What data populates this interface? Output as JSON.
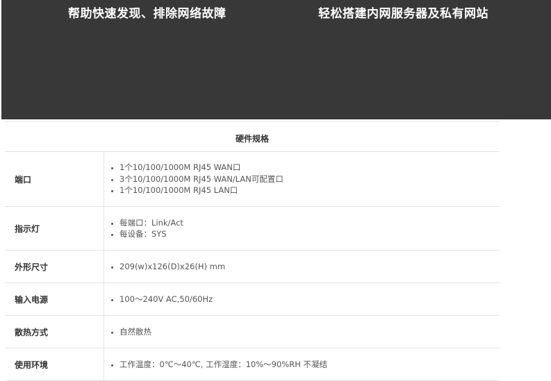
{
  "banner": {
    "left_caption": "帮助快速发现、排除网络故障",
    "right_caption": "轻松搭建内网服务器及私有网站"
  },
  "spec": {
    "title": "硬件规格",
    "rows": [
      {
        "label": "端口",
        "items": [
          "1个10/100/1000M RJ45 WAN口",
          "3个10/100/1000M RJ45 WAN/LAN可配置口",
          "1个10/100/1000M RJ45 LAN口"
        ]
      },
      {
        "label": "指示灯",
        "items": [
          "每端口：Link/Act",
          "每设备：SYS"
        ]
      },
      {
        "label": "外形尺寸",
        "items": [
          "209(w)x126(D)x26(H) mm"
        ]
      },
      {
        "label": "输入电源",
        "items": [
          "100～240V AC,50/60Hz"
        ]
      },
      {
        "label": "散热方式",
        "items": [
          "自然散热"
        ]
      },
      {
        "label": "使用环境",
        "items": [
          "工作温度：0℃～40℃, 工作湿度：10%～90%RH 不凝结"
        ]
      }
    ]
  }
}
